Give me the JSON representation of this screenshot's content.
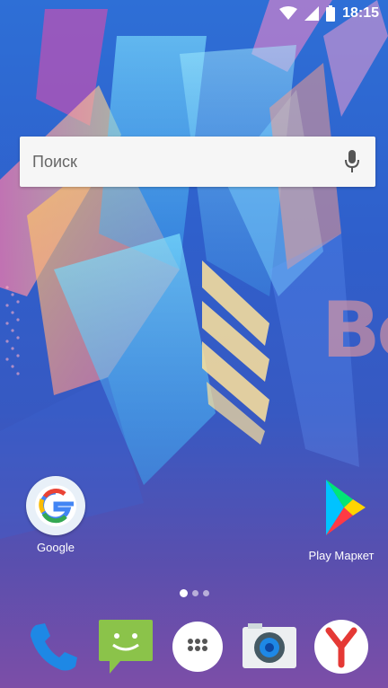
{
  "status_bar": {
    "time": "18:15",
    "icons": [
      "wifi-icon",
      "signal-icon",
      "battery-icon"
    ]
  },
  "search": {
    "placeholder": "Поиск",
    "icon": "mic-icon"
  },
  "wallpaper": {
    "text": "Bo"
  },
  "home_apps": [
    {
      "label": "Google",
      "icon": "google-icon"
    },
    {
      "label": "Play Маркет",
      "icon": "play-store-icon"
    }
  ],
  "page_indicator": {
    "count": 3,
    "active": 0
  },
  "dock": [
    {
      "icon": "phone-icon"
    },
    {
      "icon": "messages-icon"
    },
    {
      "icon": "app-drawer-icon"
    },
    {
      "icon": "camera-icon"
    },
    {
      "icon": "yandex-browser-icon"
    }
  ],
  "colors": {
    "background_top": "#2e6fd6",
    "background_bottom": "#7c4ea7",
    "phone": "#1e88e5",
    "messages": "#8bc34a",
    "yandex": "#e53935"
  }
}
